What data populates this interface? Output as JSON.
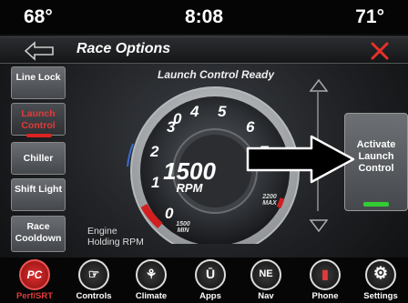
{
  "status": {
    "temp_left": "68°",
    "time": "8:08",
    "temp_right": "71°"
  },
  "header": {
    "title": "Race Options",
    "back_icon": "back-arrow-icon",
    "close_icon": "close-icon",
    "close_color": "#e8302a"
  },
  "menu": [
    {
      "label": "Line Lock",
      "active": false
    },
    {
      "label": "Launch Control",
      "active": true
    },
    {
      "label": "Chiller",
      "active": false
    },
    {
      "label": "Shift Light",
      "active": false
    },
    {
      "label": "Race Cooldown",
      "active": false
    }
  ],
  "gauge": {
    "status": "Launch Control Ready",
    "rpm": "1500",
    "unit": "RPM",
    "ticks": [
      "0",
      "1",
      "2",
      "3",
      "4",
      "5",
      "6",
      "7"
    ],
    "min_value": "1500",
    "min_label": "MIN",
    "max_value": "2200",
    "max_label": "MAX"
  },
  "engine_status": {
    "line1": "Engine",
    "line2": "Holding RPM"
  },
  "activate": {
    "label": "Activate Launch Control",
    "led_color": "#33cc33"
  },
  "nav": [
    {
      "label": "Perf/SRT",
      "icon": "pc-icon",
      "glyph": "PC",
      "active": true
    },
    {
      "label": "Controls",
      "icon": "controls-icon",
      "glyph": "☞",
      "active": false
    },
    {
      "label": "Climate",
      "icon": "climate-icon",
      "glyph": "⚘",
      "active": false
    },
    {
      "label": "Apps",
      "icon": "apps-icon",
      "glyph": "Ū",
      "active": false
    },
    {
      "label": "Nav",
      "icon": "nav-icon",
      "glyph": "NE",
      "active": false
    },
    {
      "label": "Phone",
      "icon": "phone-icon",
      "glyph": "▮",
      "active": false
    },
    {
      "label": "Settings",
      "icon": "settings-icon",
      "glyph": "⚙",
      "active": false
    }
  ]
}
